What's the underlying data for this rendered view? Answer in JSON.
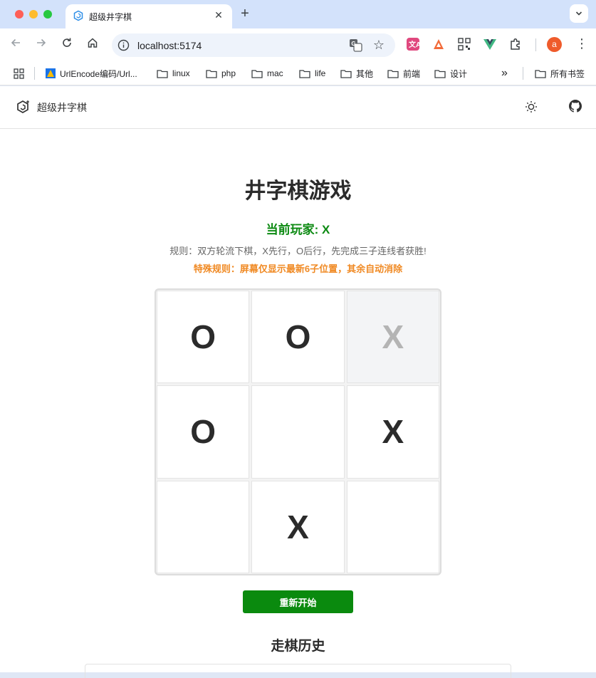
{
  "browser": {
    "tab_title": "超级井字棋",
    "tab_close": "✕",
    "new_tab": "+",
    "url": "localhost:5174",
    "bookmarks": [
      {
        "label": "UrlEncode编码/Url..."
      },
      {
        "label": "linux"
      },
      {
        "label": "php"
      },
      {
        "label": "mac"
      },
      {
        "label": "life"
      },
      {
        "label": "其他"
      },
      {
        "label": "前端"
      },
      {
        "label": "设计"
      }
    ],
    "more_bookmarks": "»",
    "all_bookmarks": "所有书签",
    "avatar_letter": "a"
  },
  "app": {
    "name": "超级井字棋"
  },
  "game": {
    "title": "井字棋游戏",
    "current_player": "当前玩家: X",
    "rule": "规则：双方轮流下棋，X先行，O后行，先完成三子连线者获胜!",
    "special_rule": "特殊规则：屏幕仅显示最新6子位置，其余自动消除",
    "board": [
      "O",
      "O",
      "X",
      "O",
      "",
      "X",
      "",
      "X",
      ""
    ],
    "fading_cell_index": 2,
    "restart_label": "重新开始",
    "history_title": "走棋历史"
  },
  "colors": {
    "accent_green": "#0a8a0e",
    "special_orange": "#f08a24",
    "tab_bar": "#d3e2fb"
  }
}
